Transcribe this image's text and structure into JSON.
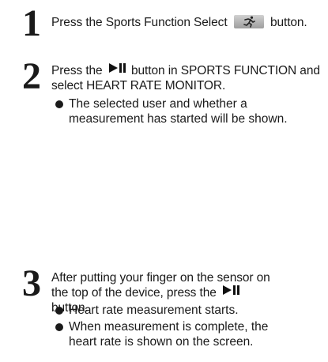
{
  "steps": [
    {
      "number": "1",
      "text_before": "Press the Sports Function Select",
      "icon": "runner-icon",
      "text_after": "button."
    },
    {
      "number": "2",
      "text_before": "Press the",
      "icon": "play-pause-icon",
      "text_after": "button in SPORTS FUNCTION and select HEART RATE MONITOR.",
      "bullets": [
        "The selected user and whether a measurement has started will be shown."
      ]
    },
    {
      "number": "3",
      "text_before": "After putting your finger on the sensor on the top of the device, press the",
      "icon": "play-pause-icon",
      "text_after": "button.",
      "bullets": [
        "Heart rate measurement starts.",
        "When measurement is complete, the heart rate is shown on the screen."
      ]
    }
  ]
}
